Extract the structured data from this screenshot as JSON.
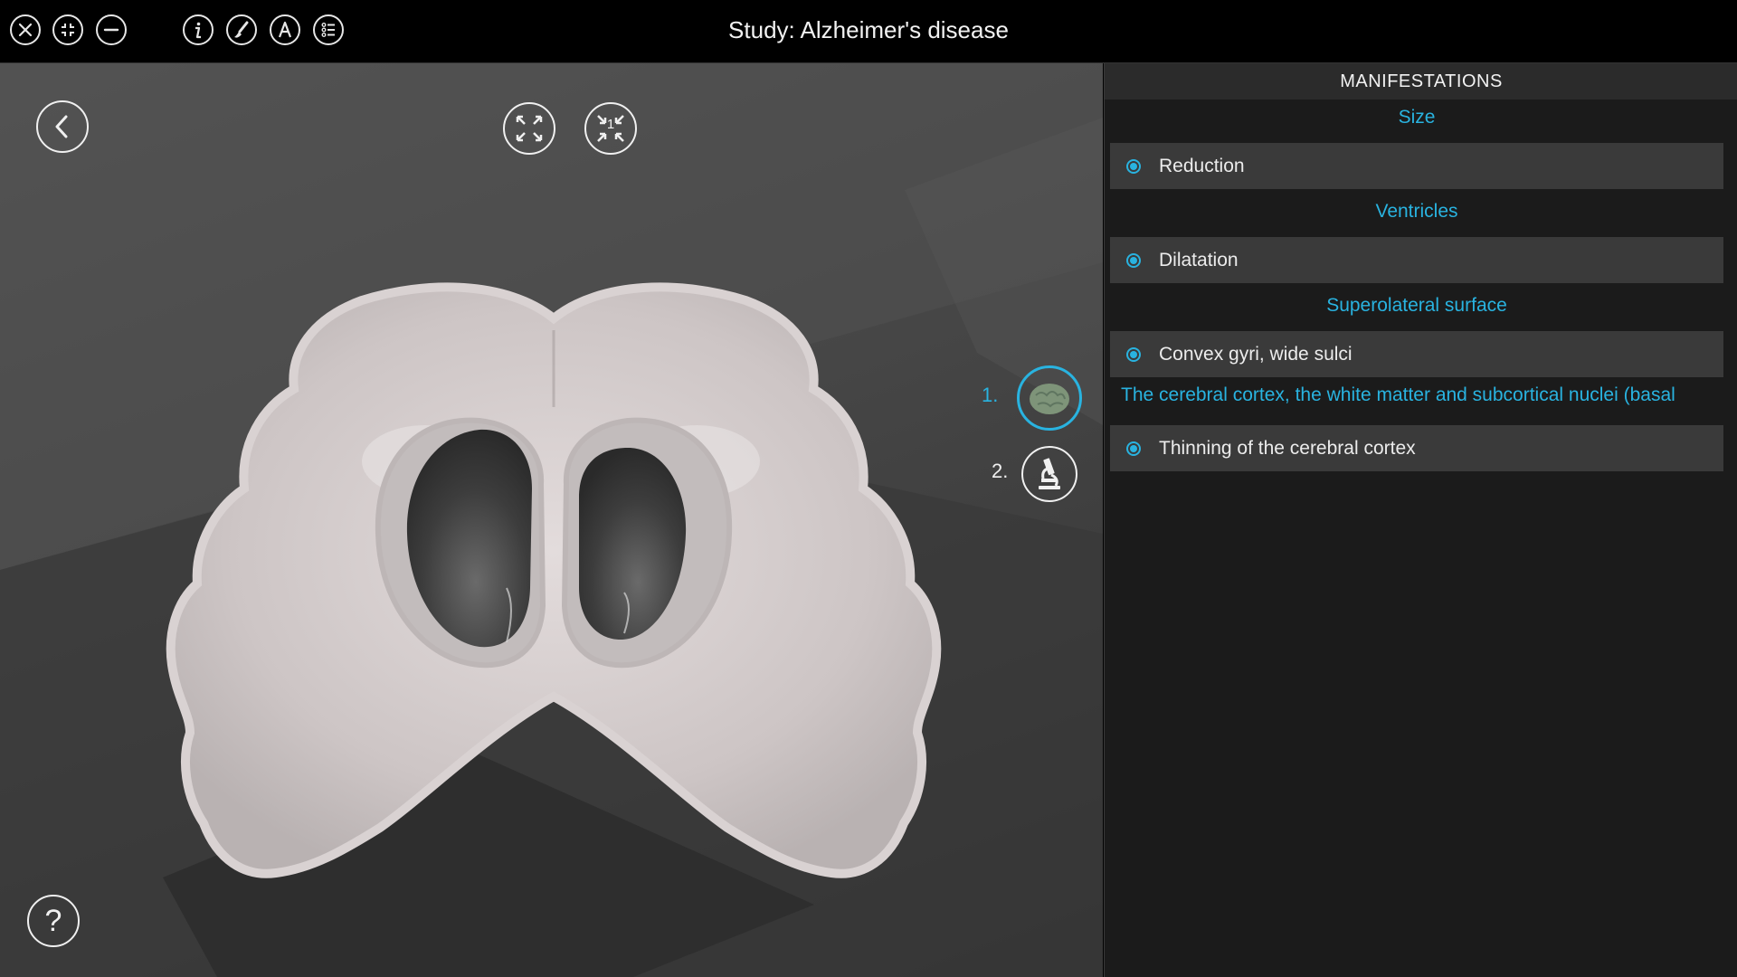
{
  "window": {
    "title": "Study: Alzheimer's disease"
  },
  "toolbar": {
    "left_icons": [
      "close-icon",
      "collapse-icon",
      "minimize-icon"
    ],
    "tool_icons": [
      "info-icon",
      "brush-icon",
      "text-icon",
      "list-icon"
    ]
  },
  "viewport": {
    "controls": [
      "back-icon",
      "expand-icon",
      "shrink-icon"
    ],
    "shrink_badge": "1",
    "stages": [
      {
        "number": "1.",
        "icon": "brain-thumbnail-icon",
        "active": true
      },
      {
        "number": "2.",
        "icon": "microscope-icon",
        "active": false
      }
    ],
    "help_icon": "?"
  },
  "panel": {
    "header": "MANIFESTATIONS",
    "sections": [
      {
        "title": "Size",
        "items": [
          "Reduction"
        ]
      },
      {
        "title": "Ventricles",
        "items": [
          "Dilatation"
        ]
      },
      {
        "title": "Superolateral surface",
        "items": [
          "Convex gyri, wide sulci"
        ]
      }
    ],
    "description": "The cerebral cortex, the white matter and subcortical nuclei (basal",
    "extra_item": "Thinning of the cerebral cortex"
  },
  "colors": {
    "accent": "#29b3e0",
    "panel_bg": "#1b1b1b",
    "item_bg": "#3a3a3a",
    "topbar_bg": "#000000"
  }
}
